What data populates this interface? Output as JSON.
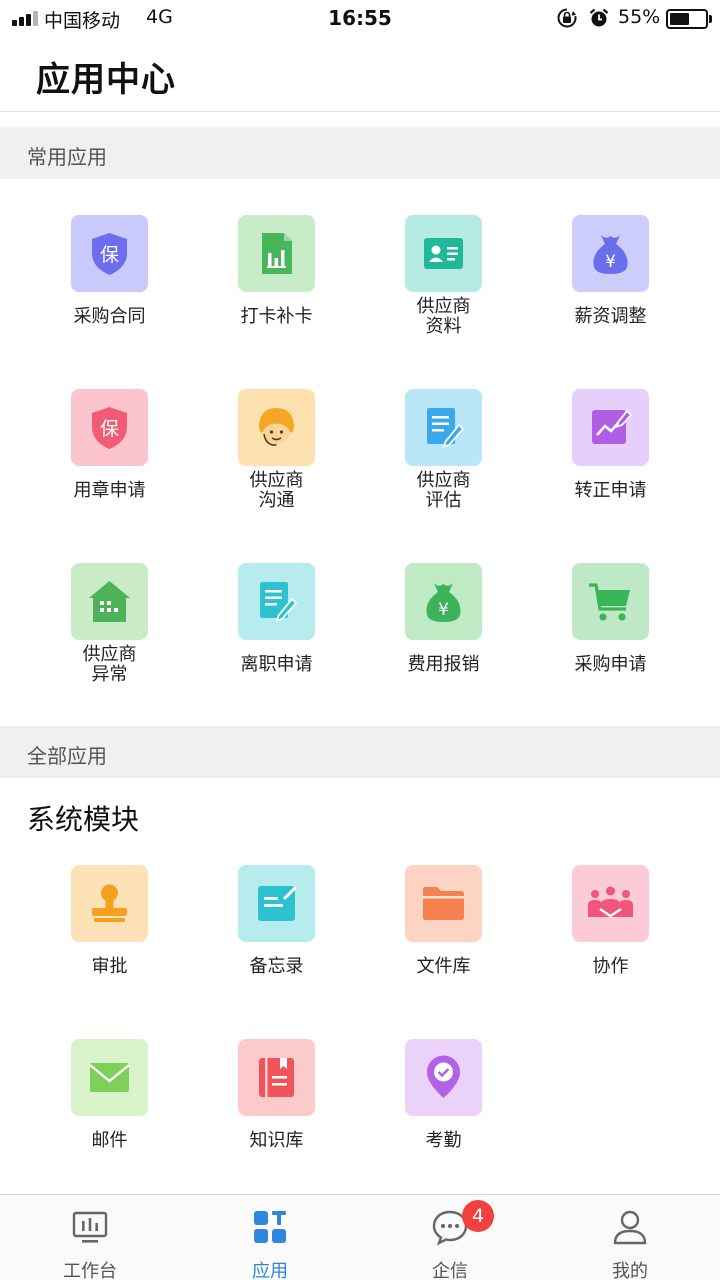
{
  "status_bar": {
    "carrier": "中国移动",
    "network": "4G",
    "time": "16:55",
    "battery": "55%",
    "battery_level": 0.55
  },
  "page": {
    "title": "应用中心"
  },
  "sections": {
    "common": {
      "title": "常用应用",
      "apps": [
        {
          "label": "采购合同",
          "icon": "shield-bao-icon",
          "tile_color": "#c9c9fb",
          "icon_color": "#6d6df0"
        },
        {
          "label": "打卡补卡",
          "icon": "chart-document-icon",
          "tile_color": "#c8ecc7",
          "icon_color": "#48b65a"
        },
        {
          "label": "供应商\n资料",
          "icon": "id-card-icon",
          "tile_color": "#b5ebe2",
          "icon_color": "#1fb89a"
        },
        {
          "label": "薪资调整",
          "icon": "money-bag-icon",
          "tile_color": "#cccdfa",
          "icon_color": "#6b6eea"
        },
        {
          "label": "用章申请",
          "icon": "shield-bao-icon",
          "tile_color": "#fcc4cd",
          "icon_color": "#f25b74"
        },
        {
          "label": "供应商\n沟通",
          "icon": "support-agent-icon",
          "tile_color": "#fde1b0",
          "icon_color": "#f5a623"
        },
        {
          "label": "供应商\n评估",
          "icon": "document-edit-icon",
          "tile_color": "#b9e6f9",
          "icon_color": "#3aa8ea"
        },
        {
          "label": "转正申请",
          "icon": "trend-edit-icon",
          "tile_color": "#e5cffb",
          "icon_color": "#b05ee6"
        },
        {
          "label": "供应商\n异常",
          "icon": "house-icon",
          "tile_color": "#c9ecc6",
          "icon_color": "#4eb259"
        },
        {
          "label": "离职申请",
          "icon": "document-edit-icon",
          "tile_color": "#b7ecef",
          "icon_color": "#2cc2cf"
        },
        {
          "label": "费用报销",
          "icon": "money-bag-icon",
          "tile_color": "#bfeac3",
          "icon_color": "#3cb25a"
        },
        {
          "label": "采购申请",
          "icon": "cart-icon",
          "tile_color": "#bfe9c6",
          "icon_color": "#39b457"
        }
      ]
    },
    "all": {
      "title": "全部应用",
      "subheading": "系统模块",
      "apps": [
        {
          "label": "审批",
          "icon": "stamp-icon",
          "tile_color": "#fde2b7",
          "icon_color": "#f3a11e"
        },
        {
          "label": "备忘录",
          "icon": "memo-icon",
          "tile_color": "#b7ecef",
          "icon_color": "#2cc2cf"
        },
        {
          "label": "文件库",
          "icon": "folder-icon",
          "tile_color": "#fdd3c3",
          "icon_color": "#f5814f"
        },
        {
          "label": "协作",
          "icon": "team-icon",
          "tile_color": "#fdcbd6",
          "icon_color": "#f2557a"
        },
        {
          "label": "邮件",
          "icon": "mail-icon",
          "tile_color": "#d8f2c9",
          "icon_color": "#7fd05a"
        },
        {
          "label": "知识库",
          "icon": "book-icon",
          "tile_color": "#fccbc9",
          "icon_color": "#f0545a"
        },
        {
          "label": "考勤",
          "icon": "location-check-icon",
          "tile_color": "#ead2f9",
          "icon_color": "#b262e6"
        }
      ]
    }
  },
  "tabbar": {
    "tabs": [
      {
        "label": "工作台",
        "icon": "dashboard-icon"
      },
      {
        "label": "应用",
        "icon": "apps-grid-icon"
      },
      {
        "label": "企信",
        "icon": "chat-bubble-icon"
      },
      {
        "label": "我的",
        "icon": "person-icon"
      }
    ],
    "active_index": 1,
    "messages_badge": "4"
  }
}
